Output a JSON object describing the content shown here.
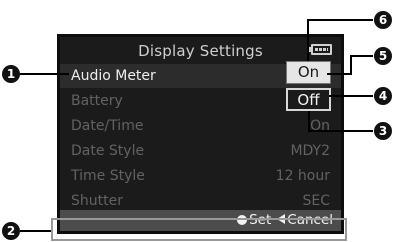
{
  "screen": {
    "title": "Display Settings",
    "battery_icon": "battery-icon",
    "items": [
      {
        "label": "Audio Meter",
        "value": ""
      },
      {
        "label": "Battery",
        "value": ""
      },
      {
        "label": "Date/Time",
        "value": "On"
      },
      {
        "label": "Date Style",
        "value": "MDY2"
      },
      {
        "label": "Time Style",
        "value": "12 hour"
      },
      {
        "label": "Shutter",
        "value": "SEC"
      }
    ],
    "footer": {
      "set_label": "Set",
      "cancel_label": "Cancel"
    }
  },
  "options": {
    "on": "On",
    "off": "Off"
  },
  "callouts": {
    "c1": "1",
    "c2": "2",
    "c3": "3",
    "c4": "4",
    "c5": "5",
    "c6": "6"
  },
  "colors": {
    "screen_bg": "#1b1b1b",
    "footer_bg": "#4c4c4c",
    "active_row_bg": "#2c2c2c",
    "callout_bg": "#111111"
  }
}
